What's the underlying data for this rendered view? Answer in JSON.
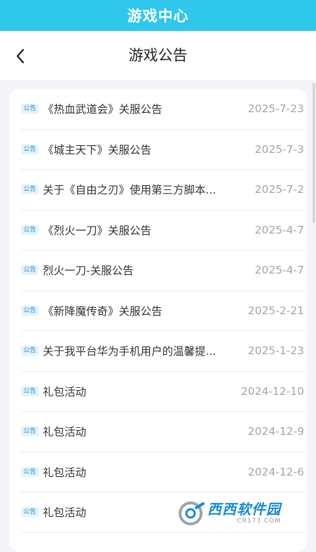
{
  "topbar": {
    "title": "游戏中心"
  },
  "header": {
    "title": "游戏公告"
  },
  "tag_label": "公告",
  "announcements": [
    {
      "title": "《热血武道会》关服公告",
      "date": "2025-7-23"
    },
    {
      "title": "《城主天下》关服公告",
      "date": "2025-7-3"
    },
    {
      "title": "关于《自由之刃》使用第三方脚本...",
      "date": "2025-7-2"
    },
    {
      "title": "《烈火一刀》关服公告",
      "date": "2025-4-7"
    },
    {
      "title": "烈火一刀-关服公告",
      "date": "2025-4-7"
    },
    {
      "title": "《新降魔传奇》关服公告",
      "date": "2025-2-21"
    },
    {
      "title": "关于我平台华为手机用户的温馨提...",
      "date": "2025-1-23"
    },
    {
      "title": "礼包活动",
      "date": "2024-12-10"
    },
    {
      "title": "礼包活动",
      "date": "2024-12-9"
    },
    {
      "title": "礼包活动",
      "date": "2024-12-6"
    },
    {
      "title": "礼包活动",
      "date": ""
    }
  ],
  "watermark": {
    "brand": "西西软件园",
    "url": "CR173.COM"
  },
  "colors": {
    "topbar": "#2fc7ec",
    "tag_bg": "#e3f3fb",
    "tag_text": "#2f8fc7",
    "date": "#a3a5ab",
    "watermark_brand": "#1a8ad6"
  }
}
